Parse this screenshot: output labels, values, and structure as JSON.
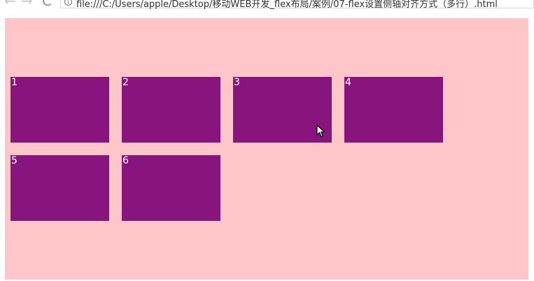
{
  "browser": {
    "back_glyph": "←",
    "forward_glyph": "→",
    "reload_glyph": "C",
    "info_glyph": "i",
    "url": "file:///C:/Users/apple/Desktop/移动WEB开发_flex布局/案例/07-flex设置侧轴对齐方式（多行）.html"
  },
  "page": {
    "items": [
      {
        "label": "1"
      },
      {
        "label": "2"
      },
      {
        "label": "3"
      },
      {
        "label": "4"
      },
      {
        "label": "5"
      },
      {
        "label": "6"
      }
    ]
  },
  "colors": {
    "container_bg": "#ffc6c9",
    "item_bg": "#88157e",
    "item_text": "#ffffff"
  },
  "icons": {
    "cursor": "mouse-pointer-icon"
  }
}
